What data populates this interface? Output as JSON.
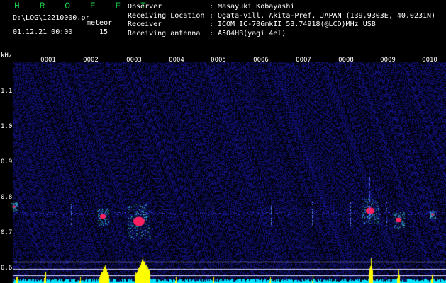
{
  "header": {
    "title": "H R O F F T",
    "file_path": "D:\\LOG\\12210000.pr",
    "meteor_label": "meteor",
    "datetime": "01.12.21 00:00",
    "meteor_count": "15"
  },
  "meta": [
    {
      "label": "Observer",
      "sep": ":",
      "value": "Masayuki Kobayashi"
    },
    {
      "label": "Receiving Location",
      "sep": ":",
      "value": "Ogata-vill. Akita-Pref. JAPAN (139.9303E, 40.0231N)"
    },
    {
      "label": "Receiver",
      "sep": ":",
      "value": "ICOM IC-706mkII 53.74918(@LCD)MHz USB"
    },
    {
      "label": "Receiving antenna",
      "sep": ":",
      "value": "A504HB(yagi 4el)"
    }
  ],
  "axis": {
    "y_unit": "kHz",
    "y_ticks": [
      "1.1",
      "1.0",
      "0.9",
      "0.8",
      "0.7",
      "0.6"
    ],
    "time_ticks": [
      "0001",
      "0002",
      "0003",
      "0004",
      "0005",
      "0006",
      "0007",
      "0008",
      "0009",
      "0010"
    ]
  },
  "colors": {
    "title": "#19d14a",
    "noise": "#0a0a5a",
    "echo_core": "#ff2060",
    "echo_halo": "#40e0ff",
    "histogram": "#ffff00",
    "baseline": "#00e5ff"
  }
}
